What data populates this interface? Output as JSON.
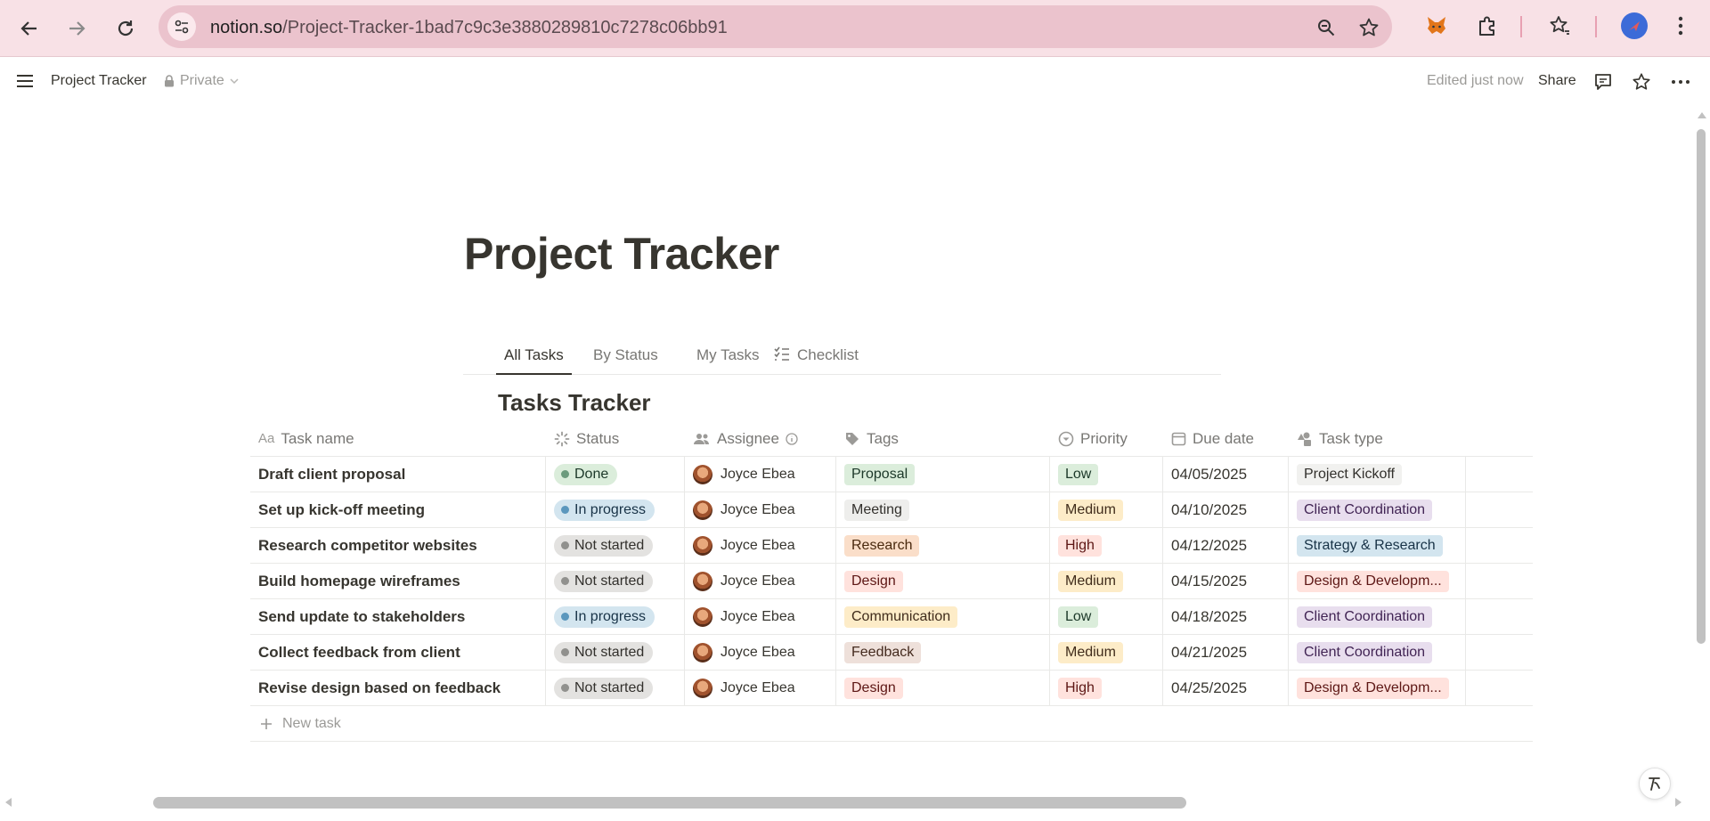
{
  "browser": {
    "url_host": "notion.so",
    "url_path": "/Project-Tracker-1bad7c9c3e3880289810c7278c06bb91"
  },
  "topbar": {
    "breadcrumb": "Project Tracker",
    "privacy": "Private",
    "edited": "Edited just now",
    "share": "Share"
  },
  "page": {
    "title": "Project Tracker",
    "tabs": [
      {
        "label": "All Tasks",
        "active": true
      },
      {
        "label": "By Status",
        "active": false
      },
      {
        "label": "My Tasks",
        "active": false
      },
      {
        "label": "Checklist",
        "active": false
      }
    ],
    "database_title": "Tasks Tracker"
  },
  "table": {
    "headers": {
      "name": "Task name",
      "name_icon": "Aa",
      "status": "Status",
      "assignee": "Assignee",
      "tags": "Tags",
      "priority": "Priority",
      "due": "Due date",
      "type": "Task type"
    },
    "rows": [
      {
        "name": "Draft client proposal",
        "status": "Done",
        "assignee": "Joyce Ebea",
        "tag": "Proposal",
        "priority": "Low",
        "due": "04/05/2025",
        "type": "Project Kickoff"
      },
      {
        "name": "Set up kick-off meeting",
        "status": "In progress",
        "assignee": "Joyce Ebea",
        "tag": "Meeting",
        "priority": "Medium",
        "due": "04/10/2025",
        "type": "Client Coordination"
      },
      {
        "name": "Research competitor websites",
        "status": "Not started",
        "assignee": "Joyce Ebea",
        "tag": "Research",
        "priority": "High",
        "due": "04/12/2025",
        "type": "Strategy & Research"
      },
      {
        "name": "Build homepage wireframes",
        "status": "Not started",
        "assignee": "Joyce Ebea",
        "tag": "Design",
        "priority": "Medium",
        "due": "04/15/2025",
        "type": "Design & Developm..."
      },
      {
        "name": "Send update to stakeholders",
        "status": "In progress",
        "assignee": "Joyce Ebea",
        "tag": "Communication",
        "priority": "Low",
        "due": "04/18/2025",
        "type": "Client Coordination"
      },
      {
        "name": "Collect feedback from client",
        "status": "Not started",
        "assignee": "Joyce Ebea",
        "tag": "Feedback",
        "priority": "Medium",
        "due": "04/21/2025",
        "type": "Client Coordination"
      },
      {
        "name": "Revise design based on feedback",
        "status": "Not started",
        "assignee": "Joyce Ebea",
        "tag": "Design",
        "priority": "High",
        "due": "04/25/2025",
        "type": "Design & Developm..."
      }
    ],
    "new_task": "New task"
  },
  "colors": {
    "status": {
      "Done": {
        "bg": "#dbeddb",
        "fg": "#1c3829",
        "dot": "#6c9b7d"
      },
      "In progress": {
        "bg": "#d3e5ef",
        "fg": "#183347",
        "dot": "#5b97bd"
      },
      "Not started": {
        "bg": "#e3e2e0",
        "fg": "#32302c",
        "dot": "#91918e"
      }
    },
    "tags": {
      "Proposal": {
        "bg": "#dbeddb",
        "fg": "#1c3829"
      },
      "Meeting": {
        "bg": "#eeeeec",
        "fg": "#32302c"
      },
      "Research": {
        "bg": "#fadec9",
        "fg": "#49290e"
      },
      "Design": {
        "bg": "#ffe2dd",
        "fg": "#5d1715"
      },
      "Communication": {
        "bg": "#fdecc8",
        "fg": "#402c1b"
      },
      "Feedback": {
        "bg": "#eee0da",
        "fg": "#442a1e"
      }
    },
    "priority": {
      "Low": {
        "bg": "#dbeddb",
        "fg": "#1c3829"
      },
      "Medium": {
        "bg": "#fdecc8",
        "fg": "#402c1b"
      },
      "High": {
        "bg": "#ffe2dd",
        "fg": "#5d1715"
      }
    },
    "type": {
      "Project Kickoff": {
        "bg": "#f1f1ef",
        "fg": "#32302c"
      },
      "Client Coordination": {
        "bg": "#e8deee",
        "fg": "#412454"
      },
      "Strategy & Research": {
        "bg": "#d3e5ef",
        "fg": "#183347"
      },
      "Design & Developm...": {
        "bg": "#ffe2dd",
        "fg": "#5d1715"
      }
    }
  },
  "icons": {
    "back": "arrow-left-icon",
    "forward": "arrow-right-icon",
    "reload": "reload-icon",
    "site_info": "tune-icon",
    "zoom": "zoom-icon",
    "bookmark": "star-icon",
    "extensions": [
      "metamask-icon",
      "puzzle-icon"
    ],
    "bookmarks_bar": "star-list-icon",
    "comment": "comment-icon",
    "favorite": "star-icon",
    "more": "more-icon"
  }
}
